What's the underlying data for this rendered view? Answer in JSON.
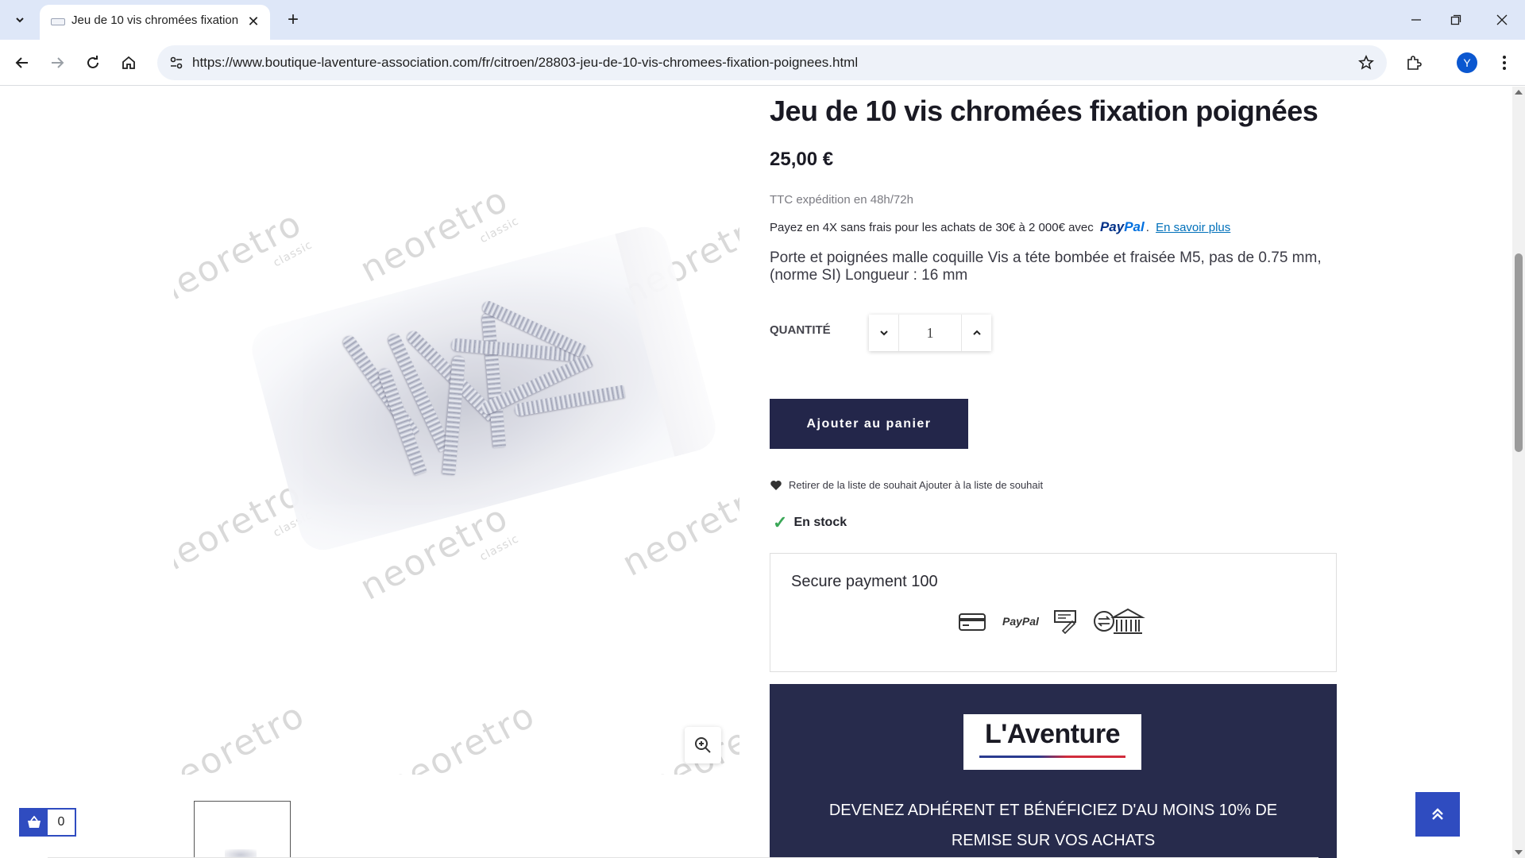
{
  "browser": {
    "tab_title": "Jeu de 10 vis chromées fixation",
    "url": "https://www.boutique-laventure-association.com/fr/citroen/28803-jeu-de-10-vis-chromees-fixation-poignees.html",
    "profile_initial": "Y"
  },
  "product": {
    "title": "Jeu de 10 vis chromées fixation poignées",
    "price": "25,00 €",
    "tax_note": "TTC expédition en 48h/72h",
    "paypal": {
      "text": "Payez en 4X sans frais pour les achats de 30€ à 2 000€ avec",
      "logo_pay": "Pay",
      "logo_pal": "Pal",
      "link": "En savoir plus"
    },
    "description": "Porte et poignées malle coquille Vis a téte bombée et fraisée M5, pas de 0.75 mm, (norme SI) Longueur : 16 mm",
    "quantity_label": "QUANTITÉ",
    "quantity_value": "1",
    "add_to_cart": "Ajouter au panier",
    "wishlist": "Retirer de la liste de souhait Ajouter à la liste de souhait",
    "stock": "En stock"
  },
  "image": {
    "watermark": "neoretro",
    "watermark_sub": "classic"
  },
  "secure_payment": {
    "title": "Secure payment 100",
    "paypal_label": "PayPal",
    "icons": [
      "credit-card-icon",
      "paypal-icon",
      "cheque-icon",
      "bank-transfer-icon"
    ]
  },
  "promo": {
    "logo": "L'Aventure",
    "text": "DEVENEZ ADHÉRENT ET BÉNÉFICIEZ D'AU MOINS 10% DE REMISE SUR VOS ACHATS"
  },
  "float_cart": {
    "count": "0"
  },
  "colors": {
    "primary_dark": "#23264a",
    "accent_blue": "#2f4cc0",
    "stock_green": "#3aa757",
    "paypal_blue": "#003087"
  }
}
